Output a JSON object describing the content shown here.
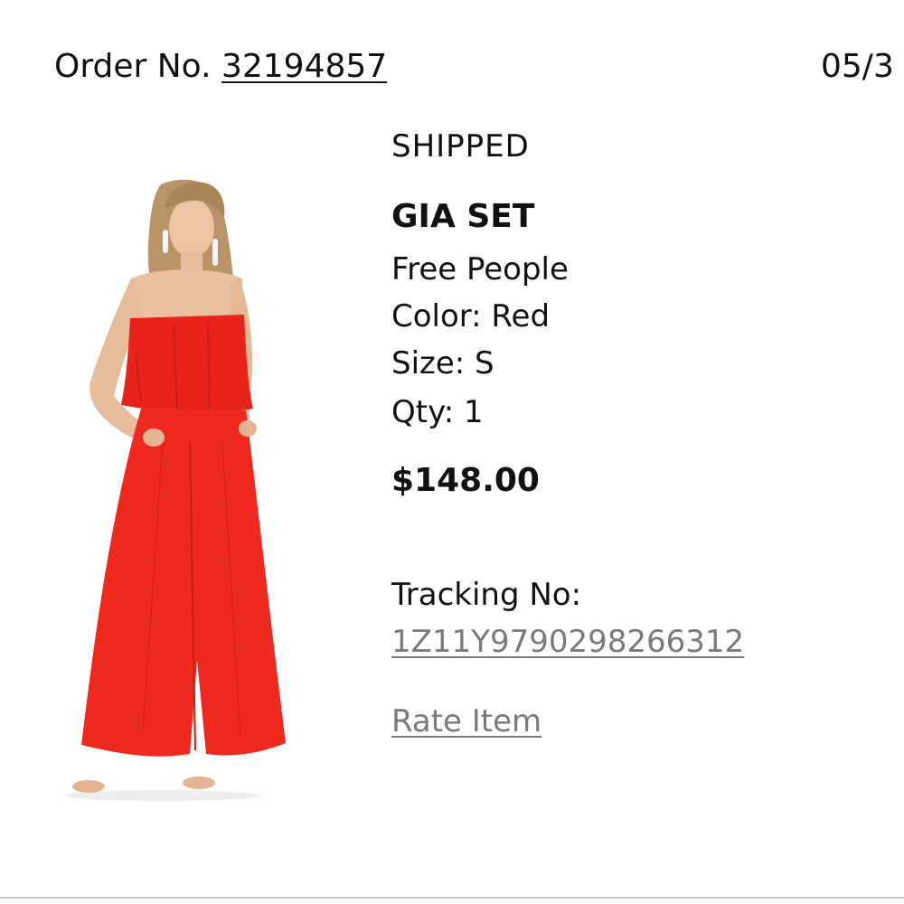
{
  "order": {
    "label": "Order No. ",
    "number": "32194857",
    "date": "05/3"
  },
  "item": {
    "status": "SHIPPED",
    "name": "GIA SET",
    "brand": "Free People",
    "color": "Color: Red",
    "size": "Size: S",
    "qty": "Qty: 1",
    "price": "$148.00",
    "tracking_label": "Tracking No:",
    "tracking_number": "1Z11Y9790298266312",
    "rate_label": "Rate Item",
    "image_icon": "red-strapless-jumpsuit-photo"
  },
  "colors": {
    "text": "#111111",
    "link": "#7a7a7a",
    "garment": "#e8231c"
  }
}
